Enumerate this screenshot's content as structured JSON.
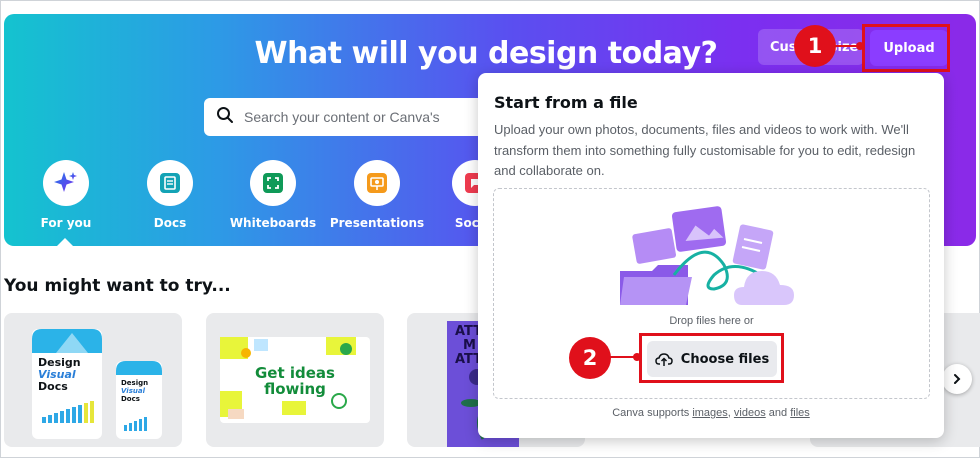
{
  "hero": {
    "title": "What will you design today?",
    "custom_button_label": "Custom size",
    "upload_button_label": "Upload",
    "search_placeholder": "Search your content or Canva's"
  },
  "categories": [
    {
      "label": "For you",
      "icon": "sparkle-icon"
    },
    {
      "label": "Docs",
      "icon": "doc-icon"
    },
    {
      "label": "Whiteboards",
      "icon": "whiteboard-icon"
    },
    {
      "label": "Presentations",
      "icon": "presentation-icon"
    },
    {
      "label": "Social",
      "icon": "social-icon"
    }
  ],
  "section": {
    "title": "You might want to try..."
  },
  "cards": [
    {
      "line1": "Design",
      "line2": "Visual",
      "line3": "Docs"
    },
    {
      "line1": "Get ideas",
      "line2": "flowing"
    },
    {
      "line1": "ATT",
      "line2": "M",
      "line3": "ATTE"
    }
  ],
  "popover": {
    "title": "Start from a file",
    "description": "Upload your own photos, documents, files and videos to work with. We'll transform them into something fully customisable for you to edit, redesign and collaborate on.",
    "drop_text": "Drop files here or",
    "choose_button_label": "Choose files",
    "support_prefix": "Canva supports",
    "support_images": "images",
    "support_videos": "videos",
    "support_and": "and",
    "support_files": "files"
  },
  "annotations": {
    "marker1": "1",
    "marker2": "2"
  },
  "colors": {
    "accent_red": "#e0101b",
    "upload_purple": "#8b3dff"
  }
}
